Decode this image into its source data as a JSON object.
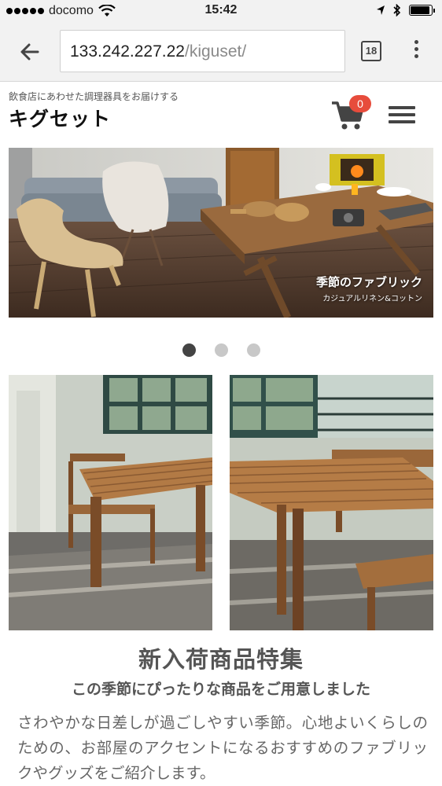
{
  "status_bar": {
    "carrier": "docomo",
    "time": "15:42",
    "battery_level": 0.85
  },
  "browser": {
    "url_host": "133.242.227.22",
    "url_path": "/kiguset/",
    "tab_count": "18"
  },
  "site": {
    "tagline": "飲食店にあわせた調理器具をお届けする",
    "title": "キグセット",
    "cart_count": "0"
  },
  "hero": {
    "caption_title": "季節のファブリック",
    "caption_sub": "カジュアルリネン&コットン",
    "slide_count": 3,
    "active_slide": 1
  },
  "feature": {
    "title": "新入荷商品特集",
    "subtitle": "この季節にぴったりな商品をご用意しました",
    "description": "さわやかな日差しが過ごしやすい季節。心地よいくらしのための、お部屋のアクセントになるおすすめのファブリックやグッズをご紹介します。"
  },
  "colors": {
    "badge": "#e74c3c",
    "icon": "#444444",
    "browser_bar": "#f2f2f2"
  }
}
